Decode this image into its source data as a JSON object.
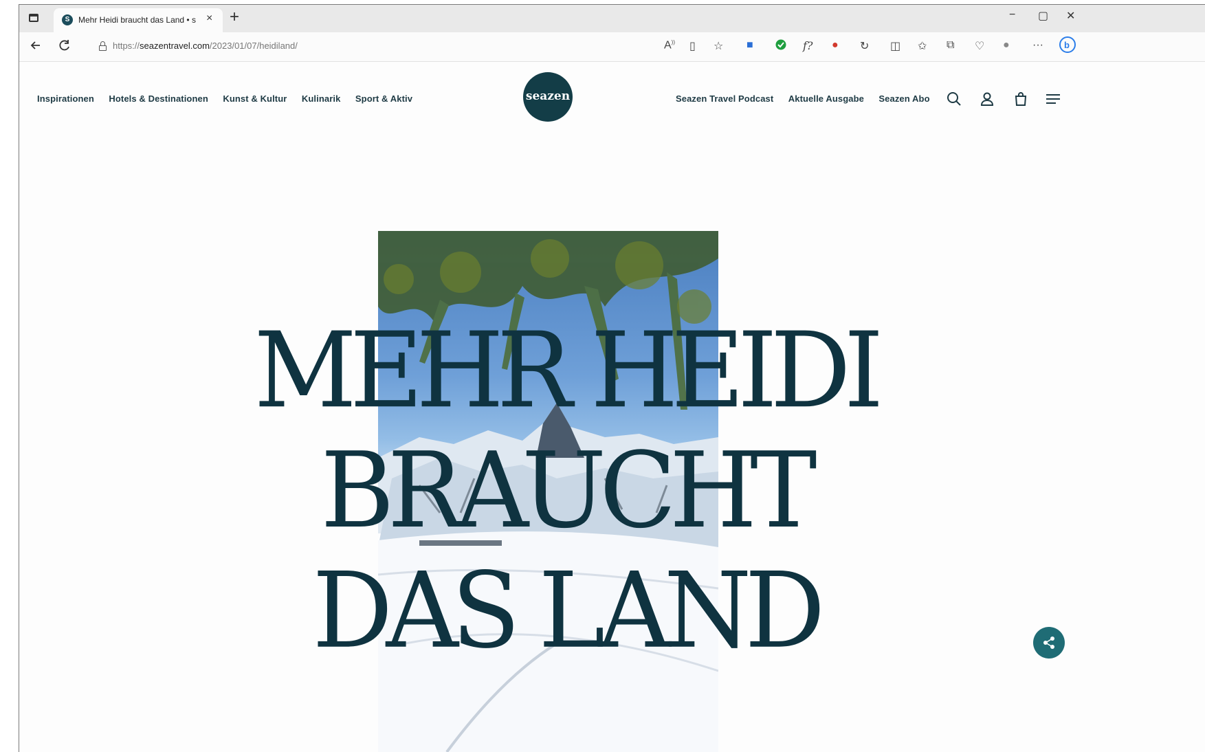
{
  "browser": {
    "tab_title": "Mehr Heidi braucht das Land • s",
    "tab_close": "×",
    "new_tab": "+",
    "window_controls": {
      "minimize": "−",
      "maximize": "▢",
      "close": "✕"
    },
    "url_prefix": "https://",
    "url_host": "seazentravel.com",
    "url_path": "/2023/01/07/heidiland/",
    "toolbar_icons": [
      "read-aloud-icon",
      "immersive-reader-icon",
      "favorite-icon",
      "translate-icon",
      "shield-check-icon",
      "formula-icon",
      "extension-icon",
      "refresh-circle-icon",
      "split-screen-icon",
      "favorites-icon",
      "collections-icon",
      "health-icon",
      "profile-icon",
      "more-icon",
      "bing-icon"
    ],
    "more_label": "···"
  },
  "site": {
    "logo_text": "seazen",
    "nav_left": [
      "Inspirationen",
      "Hotels & Destinationen",
      "Kunst & Kultur",
      "Kulinarik",
      "Sport & Aktiv"
    ],
    "nav_right": [
      "Seazen Travel Podcast",
      "Aktuelle Ausgabe",
      "Seazen Abo"
    ],
    "header_icons": [
      "search-icon",
      "account-icon",
      "cart-icon",
      "menu-icon"
    ]
  },
  "hero": {
    "title_lines": [
      "MEHR HEIDI",
      "BRAUCHT",
      "DAS LAND"
    ],
    "image": "snowy-alpine-mountain-landscape"
  },
  "colors": {
    "brand": "#133d47",
    "title": "#0f3340",
    "share": "#1f6c75"
  }
}
